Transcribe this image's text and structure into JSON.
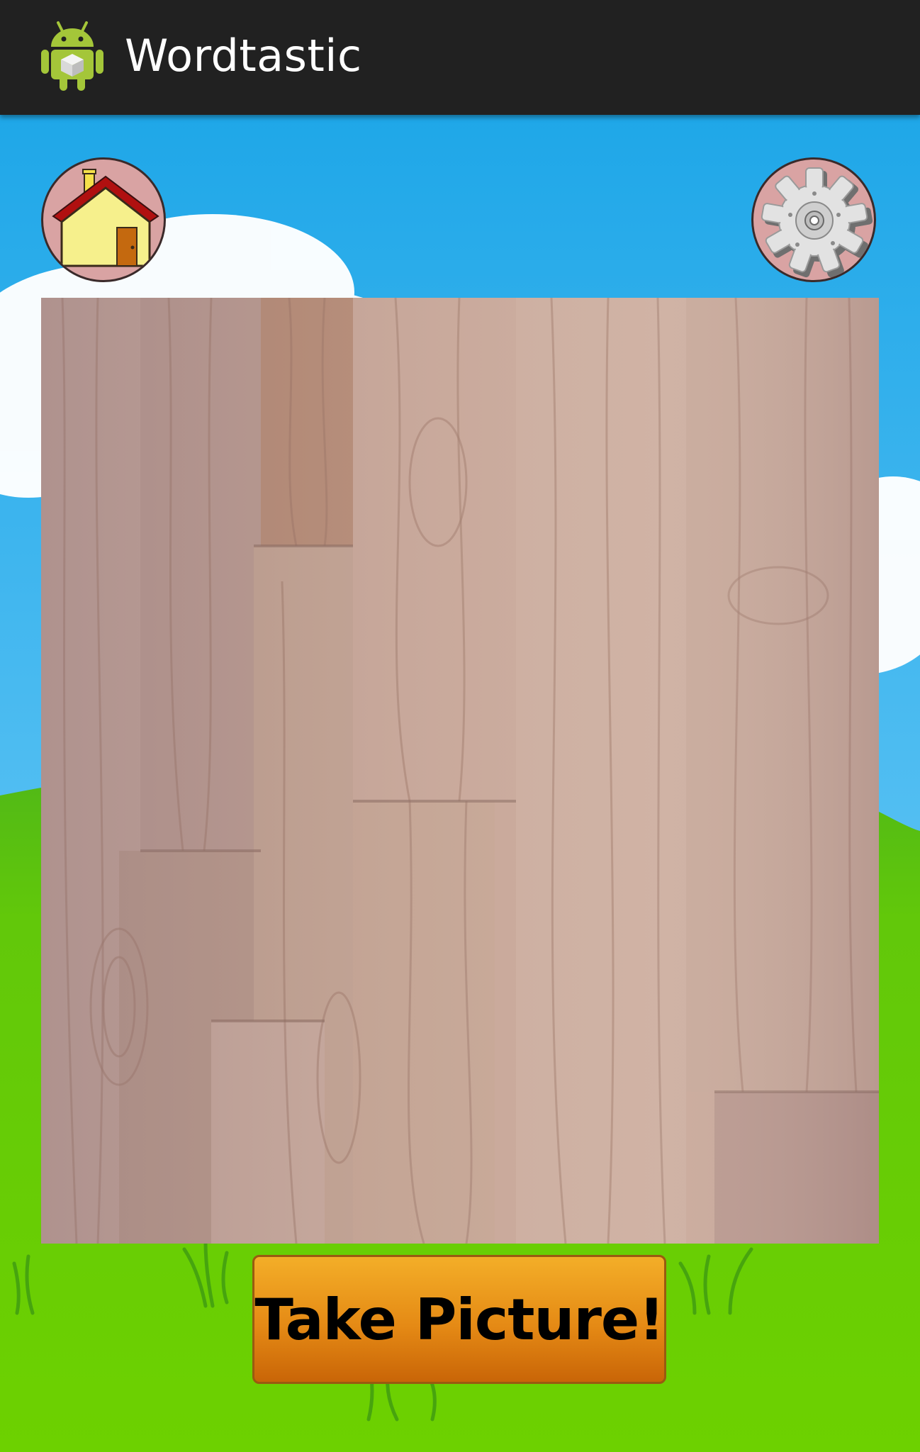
{
  "app": {
    "title": "Wordtastic",
    "icon": "android-robot-icon"
  },
  "toolbar": {
    "home_icon": "home-icon",
    "settings_icon": "gear-icon"
  },
  "camera": {
    "preview_content": "wood-floor-camera-preview"
  },
  "actions": {
    "take_picture_label": "Take Picture!"
  },
  "colors": {
    "action_bar": "#212121",
    "sky": "#2fb2ec",
    "grass": "#6dd100",
    "button_orange": "#e58a15"
  }
}
